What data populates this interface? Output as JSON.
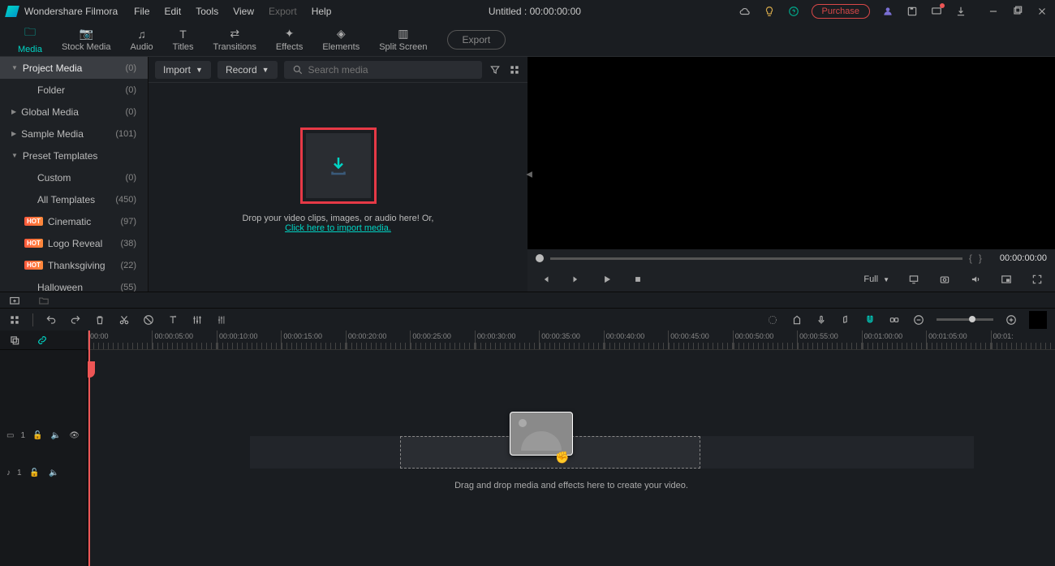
{
  "app": {
    "name": "Wondershare Filmora"
  },
  "menu": {
    "file": "File",
    "edit": "Edit",
    "tools": "Tools",
    "view": "View",
    "export": "Export",
    "help": "Help"
  },
  "title": "Untitled : 00:00:00:00",
  "purchase": "Purchase",
  "tabs": {
    "media": "Media",
    "stock": "Stock Media",
    "audio": "Audio",
    "titles": "Titles",
    "transitions": "Transitions",
    "effects": "Effects",
    "elements": "Elements",
    "split": "Split Screen",
    "export_btn": "Export"
  },
  "sidebar": {
    "project": {
      "label": "Project Media",
      "count": "(0)"
    },
    "folder": {
      "label": "Folder",
      "count": "(0)"
    },
    "global": {
      "label": "Global Media",
      "count": "(0)"
    },
    "sample": {
      "label": "Sample Media",
      "count": "(101)"
    },
    "preset": {
      "label": "Preset Templates"
    },
    "custom": {
      "label": "Custom",
      "count": "(0)"
    },
    "alltpl": {
      "label": "All Templates",
      "count": "(450)"
    },
    "cinematic": {
      "label": "Cinematic",
      "count": "(97)"
    },
    "logoreveal": {
      "label": "Logo Reveal",
      "count": "(38)"
    },
    "thanksgiving": {
      "label": "Thanksgiving",
      "count": "(22)"
    },
    "halloween": {
      "label": "Halloween",
      "count": "(55)"
    },
    "hot": "HOT"
  },
  "media_toolbar": {
    "import": "Import",
    "record": "Record",
    "search_ph": "Search media"
  },
  "drop": {
    "msg": "Drop your video clips, images, or audio here! Or,",
    "link": "Click here to import media."
  },
  "preview": {
    "brackets_l": "{",
    "brackets_r": "}",
    "timecode": "00:00:00:00",
    "quality": "Full"
  },
  "ruler": [
    "00:00",
    "00:00:05:00",
    "00:00:10:00",
    "00:00:15:00",
    "00:00:20:00",
    "00:00:25:00",
    "00:00:30:00",
    "00:00:35:00",
    "00:00:40:00",
    "00:00:45:00",
    "00:00:50:00",
    "00:00:55:00",
    "00:01:00:00",
    "00:01:05:00",
    "00:01:"
  ],
  "timeline_msg": "Drag and drop media and effects here to create your video.",
  "track_labels": {
    "video": "1",
    "audio": "1"
  }
}
